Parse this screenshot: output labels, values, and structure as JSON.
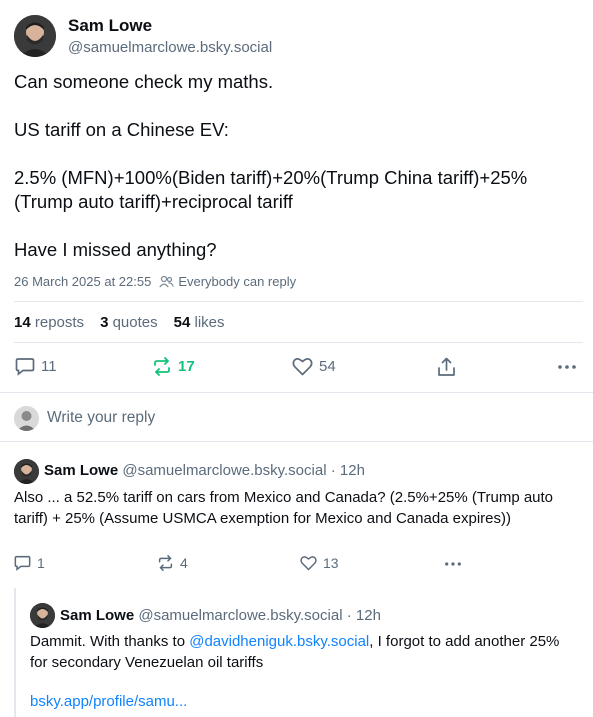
{
  "main_post": {
    "author_name": "Sam Lowe",
    "author_handle": "@samuelmarclowe.bsky.social",
    "text": "Can someone check my maths.\n\nUS tariff on a Chinese EV:\n\n2.5% (MFN)+100%(Biden tariff)+20%(Trump China tariff)+25%(Trump auto tariff)+reciprocal tariff\n\nHave I missed anything?",
    "timestamp": "26 March 2025 at 22:55",
    "reply_setting": "Everybody can reply",
    "stats": {
      "reposts_count": "14",
      "reposts_label": "reposts",
      "quotes_count": "3",
      "quotes_label": "quotes",
      "likes_count": "54",
      "likes_label": "likes"
    },
    "actions": {
      "replies": "11",
      "reposts": "17",
      "likes": "54"
    }
  },
  "composer": {
    "placeholder": "Write your reply"
  },
  "reply1": {
    "author_name": "Sam Lowe",
    "author_handle": "@samuelmarclowe.bsky.social",
    "time": "· 12h",
    "text": "Also ... a 52.5% tariff on cars from Mexico and Canada? (2.5%+25% (Trump auto tariff) + 25% (Assume USMCA exemption for Mexico and Canada expires))",
    "actions": {
      "replies": "1",
      "reposts": "4",
      "likes": "13"
    }
  },
  "reply2": {
    "author_name": "Sam Lowe",
    "author_handle": "@samuelmarclowe.bsky.social",
    "time": "· 12h",
    "text_before": "Dammit. With thanks to ",
    "mention": "@davidheniguk.bsky.social",
    "text_after": ", I forgot to add another 25% for secondary Venezuelan oil tariffs",
    "link": "bsky.app/profile/samu..."
  },
  "colors": {
    "text": "#0b0f14",
    "muted": "#5b6b7b",
    "link": "#1083fe",
    "repost_active": "#13c27a",
    "divider": "#e3e8ee"
  },
  "icons": [
    "avatar",
    "people-icon",
    "reply-icon",
    "repost-icon",
    "heart-icon",
    "share-icon",
    "more-icon"
  ]
}
